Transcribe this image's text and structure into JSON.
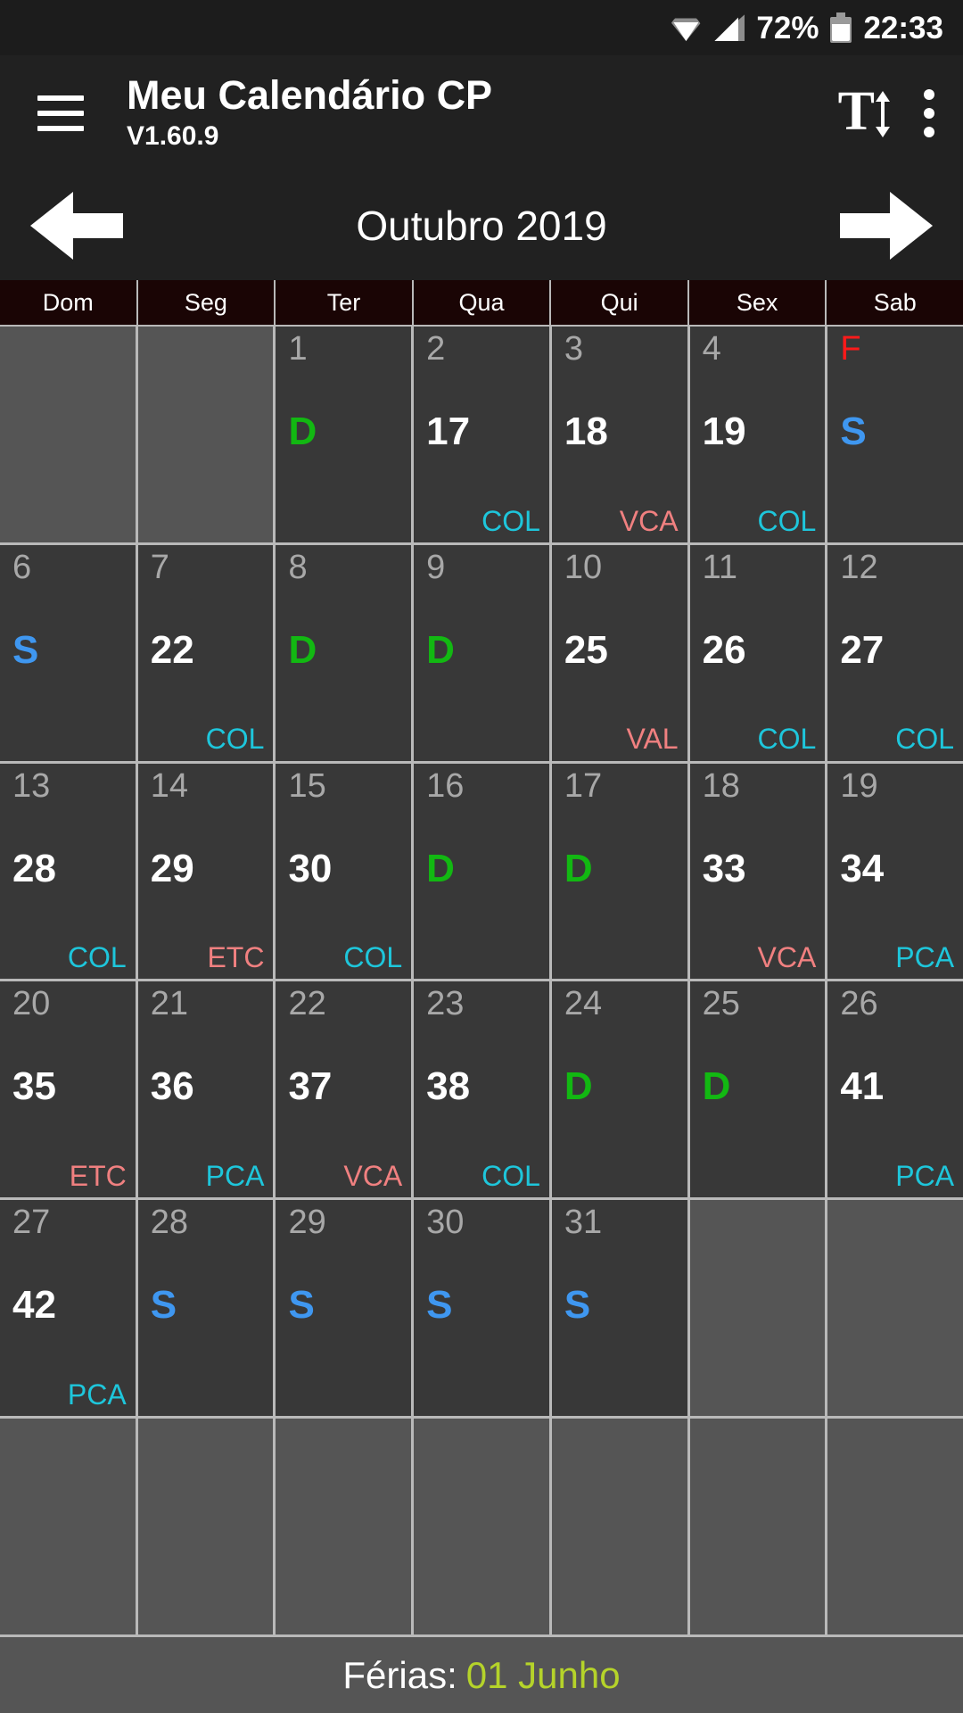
{
  "status_bar": {
    "wifi_icon": "wifi-icon",
    "signal_icon": "signal-icon",
    "battery_percent": "72%",
    "battery_icon": "battery-icon",
    "clock": "22:33"
  },
  "app_bar": {
    "menu_icon": "hamburger-menu-icon",
    "title": "Meu Calendário CP",
    "version": "V1.60.9",
    "font_size_icon": "font-size-icon",
    "font_size_glyph": "T",
    "overflow_icon": "overflow-menu-icon"
  },
  "month_nav": {
    "prev_icon": "arrow-left-icon",
    "label": "Outubro 2019",
    "next_icon": "arrow-right-icon"
  },
  "weekdays": [
    "Dom",
    "Seg",
    "Ter",
    "Qua",
    "Qui",
    "Sex",
    "Sab"
  ],
  "colors": {
    "app_bar_bg": "#212121",
    "status_bar_bg": "#1c1c1c",
    "weekday_header_bg": "#1a0505",
    "cell_bg": "#383838",
    "empty_cell_bg": "#555555",
    "grid_line": "#b9b9b9",
    "day_number": "#a8a8a8",
    "holiday_red": "#ff1a1a",
    "folga_green": "#12b812",
    "saturday_blue": "#3f97f0",
    "code_cyan": "#1ec6db",
    "code_salmon": "#f08080",
    "ferias_accent": "#b5d32a"
  },
  "weeks": [
    [
      {
        "day": "",
        "marker": "",
        "code": "",
        "empty": true
      },
      {
        "day": "",
        "marker": "",
        "code": "",
        "empty": true
      },
      {
        "day": "1",
        "marker": "D",
        "marker_kind": "folga",
        "code": ""
      },
      {
        "day": "2",
        "marker": "17",
        "marker_kind": "shift",
        "code": "COL",
        "code_kind": "col"
      },
      {
        "day": "3",
        "marker": "18",
        "marker_kind": "shift",
        "code": "VCA",
        "code_kind": "vca"
      },
      {
        "day": "4",
        "marker": "19",
        "marker_kind": "shift",
        "code": "COL",
        "code_kind": "col"
      },
      {
        "day": "F",
        "day_kind": "holiday",
        "marker": "S",
        "marker_kind": "sab",
        "code": ""
      }
    ],
    [
      {
        "day": "6",
        "marker": "S",
        "marker_kind": "sab",
        "code": ""
      },
      {
        "day": "7",
        "marker": "22",
        "marker_kind": "shift",
        "code": "COL",
        "code_kind": "col"
      },
      {
        "day": "8",
        "marker": "D",
        "marker_kind": "folga",
        "code": ""
      },
      {
        "day": "9",
        "marker": "D",
        "marker_kind": "folga",
        "code": ""
      },
      {
        "day": "10",
        "marker": "25",
        "marker_kind": "shift",
        "code": "VAL",
        "code_kind": "val"
      },
      {
        "day": "11",
        "marker": "26",
        "marker_kind": "shift",
        "code": "COL",
        "code_kind": "col"
      },
      {
        "day": "12",
        "marker": "27",
        "marker_kind": "shift",
        "code": "COL",
        "code_kind": "col"
      }
    ],
    [
      {
        "day": "13",
        "marker": "28",
        "marker_kind": "shift",
        "code": "COL",
        "code_kind": "col"
      },
      {
        "day": "14",
        "marker": "29",
        "marker_kind": "shift",
        "code": "ETC",
        "code_kind": "etc"
      },
      {
        "day": "15",
        "marker": "30",
        "marker_kind": "shift",
        "code": "COL",
        "code_kind": "col"
      },
      {
        "day": "16",
        "marker": "D",
        "marker_kind": "folga",
        "code": ""
      },
      {
        "day": "17",
        "marker": "D",
        "marker_kind": "folga",
        "code": ""
      },
      {
        "day": "18",
        "marker": "33",
        "marker_kind": "shift",
        "code": "VCA",
        "code_kind": "vca"
      },
      {
        "day": "19",
        "marker": "34",
        "marker_kind": "shift",
        "code": "PCA",
        "code_kind": "pca"
      }
    ],
    [
      {
        "day": "20",
        "marker": "35",
        "marker_kind": "shift",
        "code": "ETC",
        "code_kind": "etc"
      },
      {
        "day": "21",
        "marker": "36",
        "marker_kind": "shift",
        "code": "PCA",
        "code_kind": "pca"
      },
      {
        "day": "22",
        "marker": "37",
        "marker_kind": "shift",
        "code": "VCA",
        "code_kind": "vca"
      },
      {
        "day": "23",
        "marker": "38",
        "marker_kind": "shift",
        "code": "COL",
        "code_kind": "col"
      },
      {
        "day": "24",
        "marker": "D",
        "marker_kind": "folga",
        "code": ""
      },
      {
        "day": "25",
        "marker": "D",
        "marker_kind": "folga",
        "code": ""
      },
      {
        "day": "26",
        "marker": "41",
        "marker_kind": "shift",
        "code": "PCA",
        "code_kind": "pca"
      }
    ],
    [
      {
        "day": "27",
        "marker": "42",
        "marker_kind": "shift",
        "code": "PCA",
        "code_kind": "pca"
      },
      {
        "day": "28",
        "marker": "S",
        "marker_kind": "sab",
        "code": ""
      },
      {
        "day": "29",
        "marker": "S",
        "marker_kind": "sab",
        "code": ""
      },
      {
        "day": "30",
        "marker": "S",
        "marker_kind": "sab",
        "code": ""
      },
      {
        "day": "31",
        "marker": "S",
        "marker_kind": "sab",
        "code": ""
      },
      {
        "day": "",
        "marker": "",
        "code": "",
        "empty": true
      },
      {
        "day": "",
        "marker": "",
        "code": "",
        "empty": true
      }
    ],
    [
      {
        "day": "",
        "marker": "",
        "code": "",
        "empty": true
      },
      {
        "day": "",
        "marker": "",
        "code": "",
        "empty": true
      },
      {
        "day": "",
        "marker": "",
        "code": "",
        "empty": true
      },
      {
        "day": "",
        "marker": "",
        "code": "",
        "empty": true
      },
      {
        "day": "",
        "marker": "",
        "code": "",
        "empty": true
      },
      {
        "day": "",
        "marker": "",
        "code": "",
        "empty": true
      },
      {
        "day": "",
        "marker": "",
        "code": "",
        "empty": true
      }
    ]
  ],
  "footer": {
    "label": "Férias:",
    "value": "01 Junho"
  }
}
